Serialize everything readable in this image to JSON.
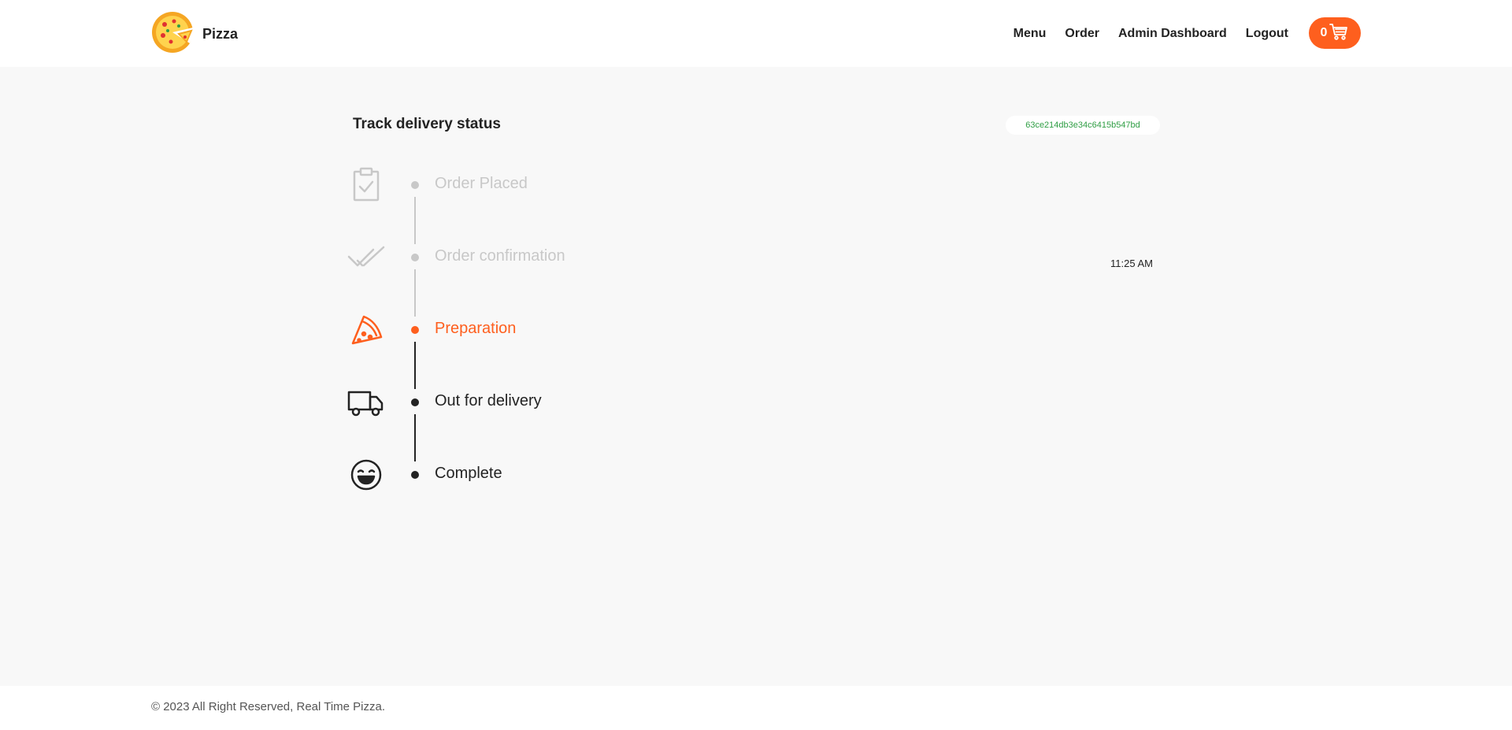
{
  "navbar": {
    "brand": "Pizza",
    "logo_icon": "pizza-logo-icon",
    "links": [
      {
        "label": "Menu"
      },
      {
        "label": "Order"
      },
      {
        "label": "Admin Dashboard"
      },
      {
        "label": "Logout"
      }
    ],
    "cart": {
      "count": "0",
      "icon": "cart-icon"
    }
  },
  "status": {
    "title": "Track delivery status",
    "order_id": "63ce214db3e34c6415b547bd",
    "time": "11:25 AM",
    "steps": [
      {
        "label": "Order Placed",
        "icon": "clipboard-check-icon",
        "state": "done"
      },
      {
        "label": "Order confirmation",
        "icon": "double-check-icon",
        "state": "done"
      },
      {
        "label": "Preparation",
        "icon": "pizza-slice-icon",
        "state": "current"
      },
      {
        "label": "Out for delivery",
        "icon": "truck-icon",
        "state": "pending"
      },
      {
        "label": "Complete",
        "icon": "smile-icon",
        "state": "pending"
      }
    ]
  },
  "footer": {
    "text": "© 2023 All Right Reserved, Real Time Pizza."
  },
  "colors": {
    "accent": "#fe5f1e",
    "done": "#c8c8c8",
    "pending": "#232323",
    "order_id": "#2f9e44"
  }
}
